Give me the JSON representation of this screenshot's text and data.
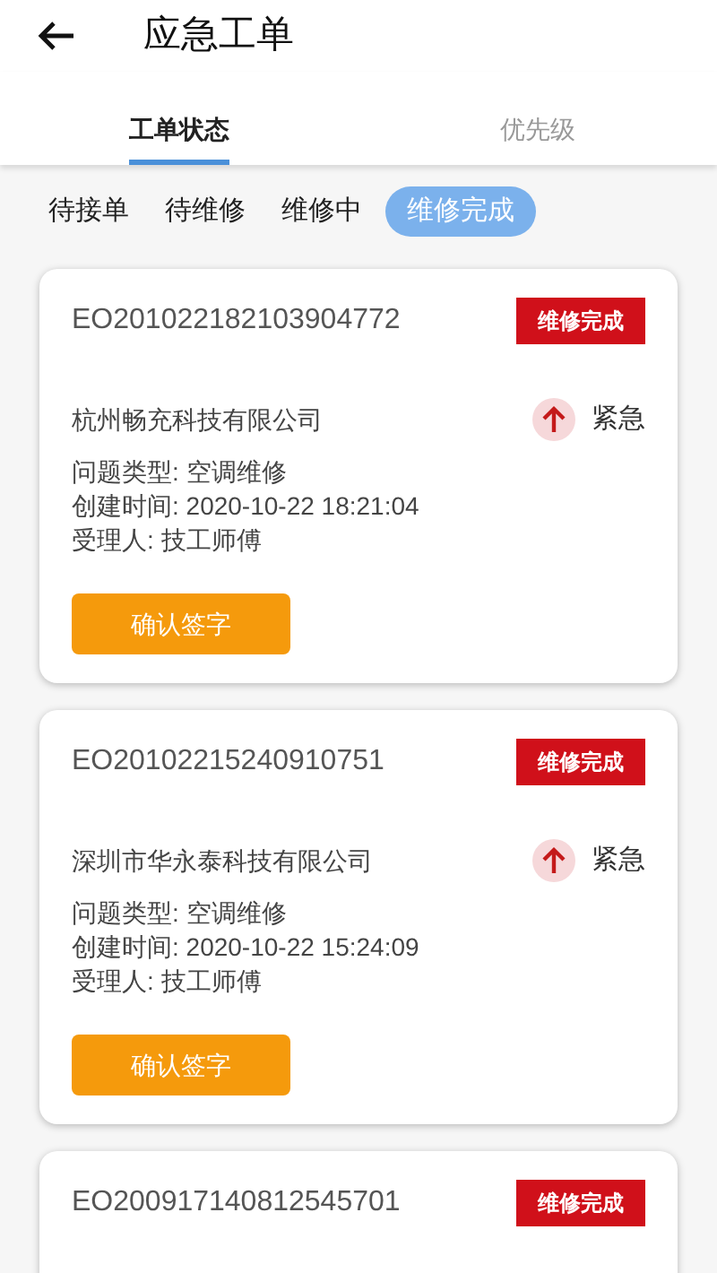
{
  "header": {
    "title": "应急工单"
  },
  "tabs": [
    {
      "label": "工单状态",
      "selected": true
    },
    {
      "label": "优先级",
      "selected": false
    }
  ],
  "filters": [
    {
      "label": "待接单",
      "selected": false
    },
    {
      "label": "待维修",
      "selected": false
    },
    {
      "label": "维修中",
      "selected": false
    },
    {
      "label": "维修完成",
      "selected": true
    }
  ],
  "orders": [
    {
      "code": "EO201022182103904772",
      "status": "维修完成",
      "company": "杭州畅充科技有限公司",
      "priority": "紧急",
      "details": [
        "问题类型: 空调维修",
        "创建时间: 2020-10-22 18:21:04",
        "受理人: 技工师傅"
      ],
      "action": "确认签字"
    },
    {
      "code": "EO20102215240910751",
      "status": "维修完成",
      "company": "深圳市华永泰科技有限公司",
      "priority": "紧急",
      "details": [
        "问题类型: 空调维修",
        "创建时间: 2020-10-22 15:24:09",
        "受理人: 技工师傅"
      ],
      "action": "确认签字"
    },
    {
      "code": "EO200917140812545701",
      "status": "维修完成"
    }
  ]
}
